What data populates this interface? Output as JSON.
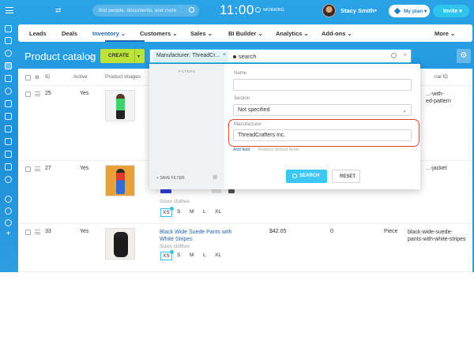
{
  "topbar": {
    "search_placeholder": "find people, documents, and more",
    "time": "11:00",
    "status": "WORKING",
    "user_name": "Stacy Smith",
    "plan_label": "My plan",
    "invite_label": "Invite"
  },
  "nav": {
    "items": [
      {
        "label": "Leads"
      },
      {
        "label": "Deals"
      },
      {
        "label": "Inventory ⌄"
      },
      {
        "label": "Customers ⌄"
      },
      {
        "label": "Sales ⌄"
      },
      {
        "label": "BI Builder ⌄"
      },
      {
        "label": "Analytics ⌄"
      },
      {
        "label": "Add-ons ⌄"
      },
      {
        "label": "More ⌄"
      }
    ]
  },
  "page": {
    "title": "Product catalog",
    "create_label": "CREATE",
    "filter_tag": "Manufacturer: ThreadCr...",
    "search_text": "search"
  },
  "grid": {
    "headers": {
      "id": "ID",
      "active": "Active",
      "images": "Product images",
      "external": "nal ID"
    },
    "rows": [
      {
        "id": "25",
        "active": "Yes",
        "ext": "...-with-\ned-pattern"
      },
      {
        "id": "27",
        "active": "Yes",
        "ext": "...-jacket",
        "sizes_label": "Sizes clothes",
        "sizes": [
          "XS",
          "S",
          "M",
          "L",
          "XL"
        ]
      },
      {
        "id": "33",
        "active": "Yes",
        "name": "Black Wide Suede Pants with White Stripes",
        "price": "$42.05",
        "qty": "0",
        "unit": "Piece",
        "ext": "black-wide-suede-pants-with-white-stripes",
        "sizes_label": "Sizes clothes",
        "sizes": [
          "XS",
          "S",
          "M",
          "L",
          "XL"
        ]
      }
    ]
  },
  "filter_popup": {
    "panel_label": "FILTERS",
    "save_filter": "SAVE FILTER",
    "name_label": "Name",
    "section_label": "Section",
    "section_value": "Not specified",
    "manufacturer_label": "Manufacturer",
    "manufacturer_value": "ThreadCrafters Inc.",
    "add_field": "Add field",
    "restore_fields": "Restore default fields",
    "search_btn": "SEARCH",
    "reset_btn": "RESET"
  },
  "colors": {
    "accent": "#2fc4ee",
    "create": "#bce338",
    "highlight": "#e0452a",
    "link": "#2067b0"
  }
}
